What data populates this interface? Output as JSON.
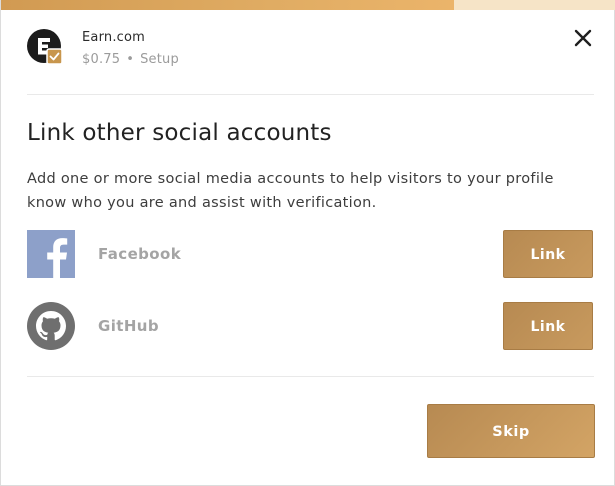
{
  "progress": {
    "fraction": 0.737,
    "fill_color": "#e0ac63",
    "track_color": "#f6e4c7"
  },
  "header": {
    "logo_icon": "earn-logo-icon",
    "brand_name": "Earn.com",
    "price": "$0.75",
    "separator": "•",
    "stage": "Setup",
    "close_icon": "close-icon"
  },
  "main": {
    "title": "Link other social accounts",
    "description": "Add one or more social media accounts to help visitors to your profile know who you are and assist with verification.",
    "accounts": [
      {
        "name": "Facebook",
        "icon": "facebook-icon",
        "button_label": "Link"
      },
      {
        "name": "GitHub",
        "icon": "github-icon",
        "button_label": "Link"
      }
    ]
  },
  "footer": {
    "skip_label": "Skip"
  },
  "colors": {
    "accent": "#c39559",
    "facebook": "#8da0c9",
    "github": "#6f6f6f"
  }
}
